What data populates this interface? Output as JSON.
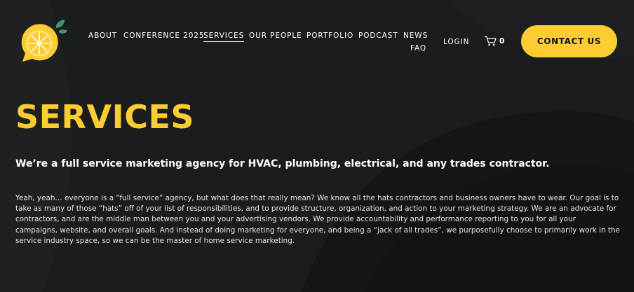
{
  "header": {
    "nav": [
      {
        "label": "ABOUT"
      },
      {
        "label": "CONFERENCE 2025"
      },
      {
        "label": "SERVICES"
      },
      {
        "label": "OUR PEOPLE"
      },
      {
        "label": "PORTFOLIO"
      },
      {
        "label": "PODCAST"
      },
      {
        "label": "NEWS"
      },
      {
        "label": "FAQ"
      }
    ],
    "active_nav": "SERVICES",
    "login_label": "LOGIN",
    "cart_count": "0",
    "cta_label": "CONTACT US",
    "logo_icon": "lemon-logo-icon",
    "cart_icon": "cart-icon"
  },
  "main": {
    "title": "SERVICES",
    "subheading": "We’re a full service marketing agency for HVAC, plumbing, electrical, and any trades contractor.",
    "body": "Yeah, yeah… everyone is a “full service” agency, but what does that really mean? We know all the hats contractors and business owners have to wear. Our goal is to take as many of those “hats” off of your list of responsibilities, and to provide structure, organization, and action to your marketing strategy. We are an advocate for contractors, and are the middle man between you and your advertising vendors. We provide accountability and performance reporting to you for all your campaigns, website, and overall goals. And instead of doing marketing for everyone, and being a “jack of all trades”, we purposefully choose to primarily work in  the service industry space, so we can be the master of home service marketing."
  },
  "colors": {
    "background": "#1a1c1e",
    "accent": "#fccc33",
    "text": "#ffffff",
    "leaf": "#3a9a6a"
  }
}
